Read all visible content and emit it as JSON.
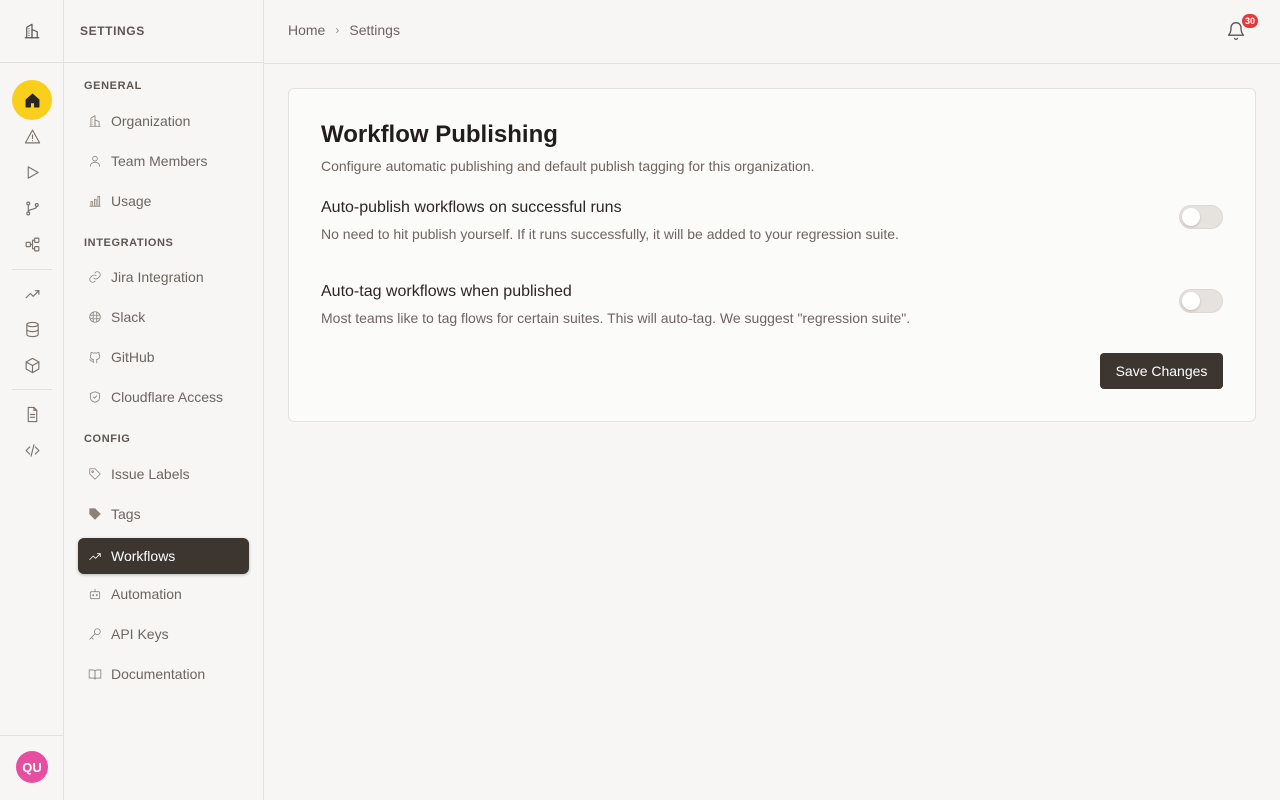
{
  "rail": {
    "logo_icon": "building-icon",
    "items": [
      {
        "icon": "home-icon",
        "active": true
      },
      {
        "icon": "alert-triangle-icon"
      },
      {
        "icon": "play-icon"
      },
      {
        "icon": "git-branch-icon"
      },
      {
        "icon": "workflow-icon"
      },
      {
        "icon": "trend-line-icon"
      },
      {
        "icon": "database-icon"
      },
      {
        "icon": "box-icon"
      },
      {
        "icon": "file-text-icon"
      },
      {
        "icon": "code-icon"
      }
    ],
    "avatar_initials": "QU"
  },
  "sidebar": {
    "title": "SETTINGS",
    "sections": {
      "general": "GENERAL",
      "integrations": "INTEGRATIONS",
      "config": "CONFIG"
    },
    "items": {
      "organization": "Organization",
      "team_members": "Team Members",
      "usage": "Usage",
      "jira": "Jira Integration",
      "slack": "Slack",
      "github": "GitHub",
      "cloudflare": "Cloudflare Access",
      "issue_labels": "Issue Labels",
      "tags": "Tags",
      "workflows": "Workflows",
      "automation": "Automation",
      "api_keys": "API Keys",
      "documentation": "Documentation"
    },
    "active_item": "Workflows"
  },
  "header": {
    "breadcrumb": [
      "Home",
      "Settings"
    ],
    "notification_count": "30"
  },
  "card": {
    "title": "Workflow Publishing",
    "description": "Configure automatic publishing and default publish tagging for this organization.",
    "settings": [
      {
        "title": "Auto-publish workflows on successful runs",
        "description": "No need to hit publish yourself. If it runs successfully, it will be added to your regression suite.",
        "enabled": false
      },
      {
        "title": "Auto-tag workflows when published",
        "description": "Most teams like to tag flows for certain suites. This will auto-tag. We suggest \"regression suite\".",
        "enabled": false
      }
    ],
    "save_label": "Save Changes"
  },
  "colors": {
    "accent": "#f9cf1c",
    "active_nav": "#3d3530",
    "badge": "#e5383b",
    "avatar": "#e64fa0"
  }
}
